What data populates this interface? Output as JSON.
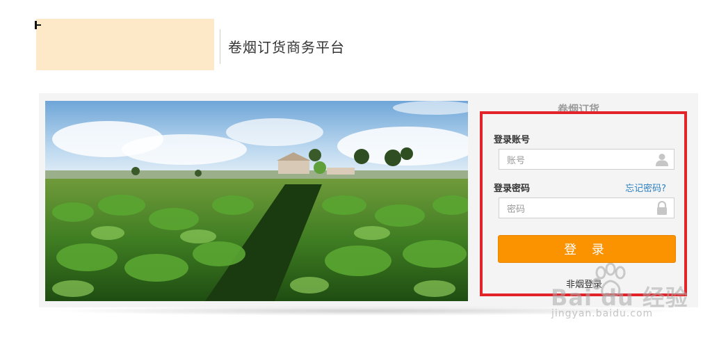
{
  "header": {
    "site_title": "卷烟订货商务平台"
  },
  "panel": {
    "heading": "卷烟订货"
  },
  "login": {
    "account_label": "登录账号",
    "account_placeholder": "账号",
    "password_label": "登录密码",
    "forgot_link": "忘记密码?",
    "password_placeholder": "密码",
    "login_button": "登 录",
    "non_tobacco_login": "非烟登录"
  },
  "watermark": {
    "brand": "Bai du 经验",
    "url": "jingyan.baidu.com"
  },
  "colors": {
    "login_button": "#fb9200",
    "highlight_border": "#e3232a",
    "forgot_link": "#2a7fc1",
    "logo_block": "#fde8c8"
  },
  "icons": {
    "account_field": "user-icon",
    "password_field": "lock-icon"
  }
}
